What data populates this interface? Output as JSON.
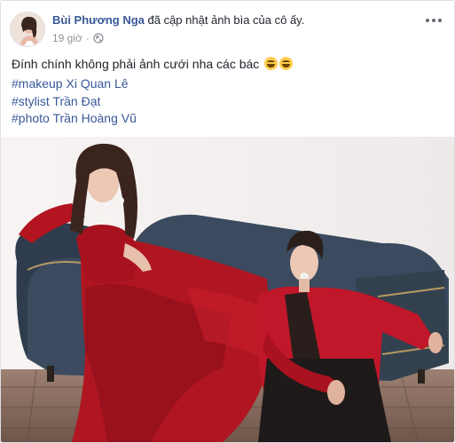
{
  "post": {
    "author": "Bùi Phương Nga",
    "action_text": "đã cập nhật ảnh bìa của cô ấy.",
    "timestamp": "19 giờ",
    "privacy_icon": "globe-icon",
    "more_icon": "more-dots-icon",
    "message": "Đính chính không phải ảnh cưới nha các bác",
    "emojis": [
      "laughing-emoji",
      "laughing-emoji"
    ],
    "hashtags": [
      "#makeup Xi Quan Lê",
      "#stylist Trần Đạt",
      "#photo Trần Hoàng Vũ"
    ]
  },
  "colors": {
    "link": "#385898",
    "text": "#1d2129",
    "muted": "#90949c",
    "sofa": "#3a4a5d",
    "dress": "#b3141f",
    "suit": "#c0172a"
  }
}
